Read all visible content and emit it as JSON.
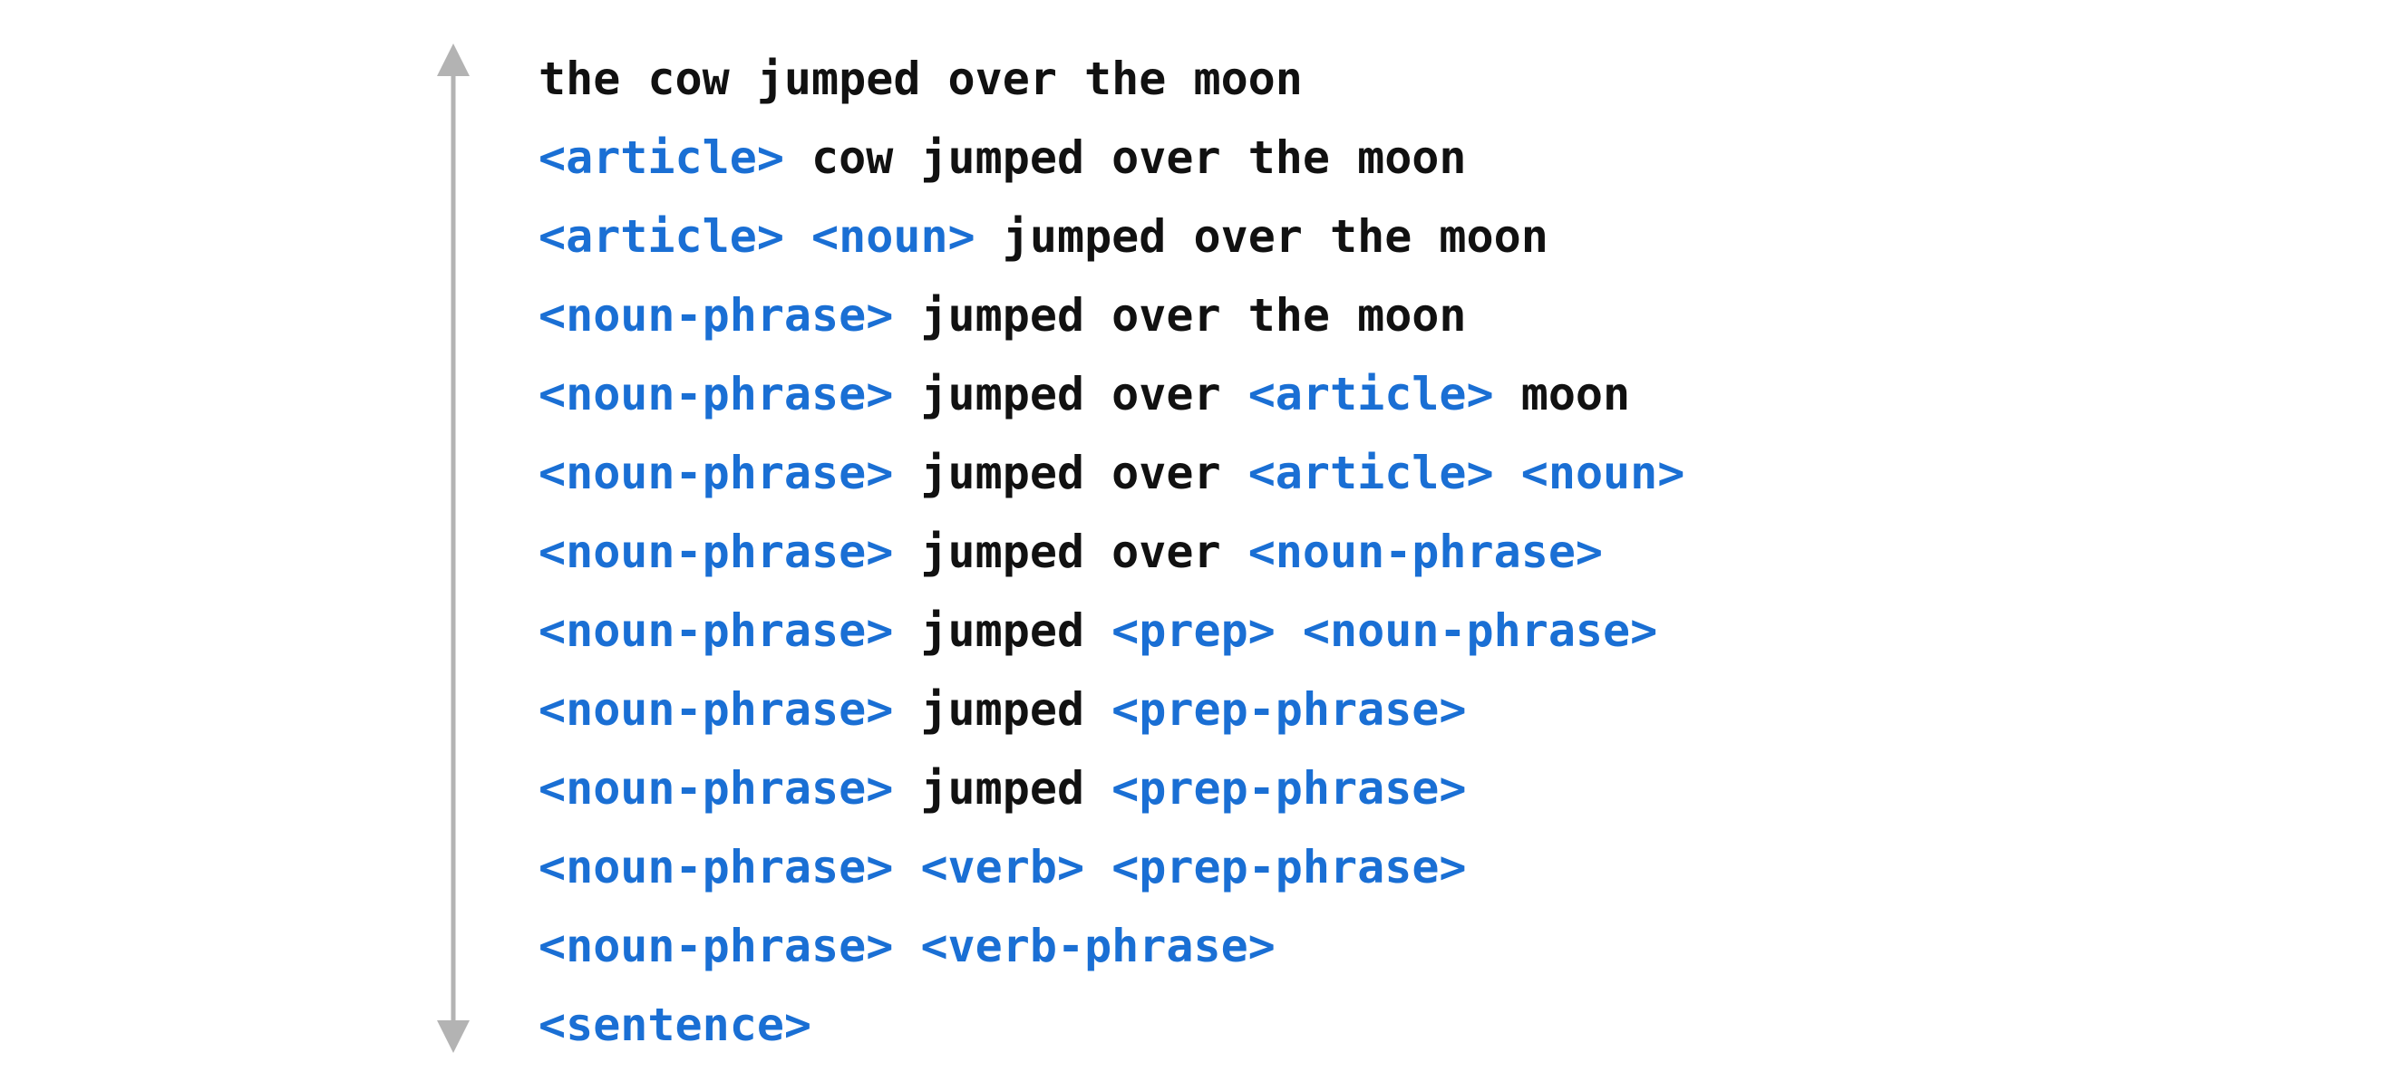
{
  "colors": {
    "terminal": "#111111",
    "nonterminal": "#1a6fd4",
    "arrow": "#b3b3b3"
  },
  "derivation": [
    [
      {
        "t": "w",
        "s": "the cow jumped over the moon"
      }
    ],
    [
      {
        "t": "n",
        "s": "<article>"
      },
      {
        "t": "w",
        "s": " cow jumped over the moon"
      }
    ],
    [
      {
        "t": "n",
        "s": "<article>"
      },
      {
        "t": "w",
        "s": " "
      },
      {
        "t": "n",
        "s": "<noun>"
      },
      {
        "t": "w",
        "s": " jumped over the moon"
      }
    ],
    [
      {
        "t": "n",
        "s": "<noun-phrase>"
      },
      {
        "t": "w",
        "s": " jumped over the moon"
      }
    ],
    [
      {
        "t": "n",
        "s": "<noun-phrase>"
      },
      {
        "t": "w",
        "s": " jumped over "
      },
      {
        "t": "n",
        "s": "<article>"
      },
      {
        "t": "w",
        "s": " moon"
      }
    ],
    [
      {
        "t": "n",
        "s": "<noun-phrase>"
      },
      {
        "t": "w",
        "s": " jumped over "
      },
      {
        "t": "n",
        "s": "<article>"
      },
      {
        "t": "w",
        "s": " "
      },
      {
        "t": "n",
        "s": "<noun>"
      }
    ],
    [
      {
        "t": "n",
        "s": "<noun-phrase>"
      },
      {
        "t": "w",
        "s": " jumped over "
      },
      {
        "t": "n",
        "s": "<noun-phrase>"
      }
    ],
    [
      {
        "t": "n",
        "s": "<noun-phrase>"
      },
      {
        "t": "w",
        "s": " jumped "
      },
      {
        "t": "n",
        "s": "<prep>"
      },
      {
        "t": "w",
        "s": " "
      },
      {
        "t": "n",
        "s": "<noun-phrase>"
      }
    ],
    [
      {
        "t": "n",
        "s": "<noun-phrase>"
      },
      {
        "t": "w",
        "s": " jumped "
      },
      {
        "t": "n",
        "s": "<prep-phrase>"
      }
    ],
    [
      {
        "t": "n",
        "s": "<noun-phrase>"
      },
      {
        "t": "w",
        "s": " jumped "
      },
      {
        "t": "n",
        "s": "<prep-phrase>"
      }
    ],
    [
      {
        "t": "n",
        "s": "<noun-phrase>"
      },
      {
        "t": "w",
        "s": " "
      },
      {
        "t": "n",
        "s": "<verb>"
      },
      {
        "t": "w",
        "s": " "
      },
      {
        "t": "n",
        "s": "<prep-phrase>"
      }
    ],
    [
      {
        "t": "n",
        "s": "<noun-phrase>"
      },
      {
        "t": "w",
        "s": " "
      },
      {
        "t": "n",
        "s": "<verb-phrase>"
      }
    ],
    [
      {
        "t": "n",
        "s": "<sentence>"
      }
    ]
  ]
}
